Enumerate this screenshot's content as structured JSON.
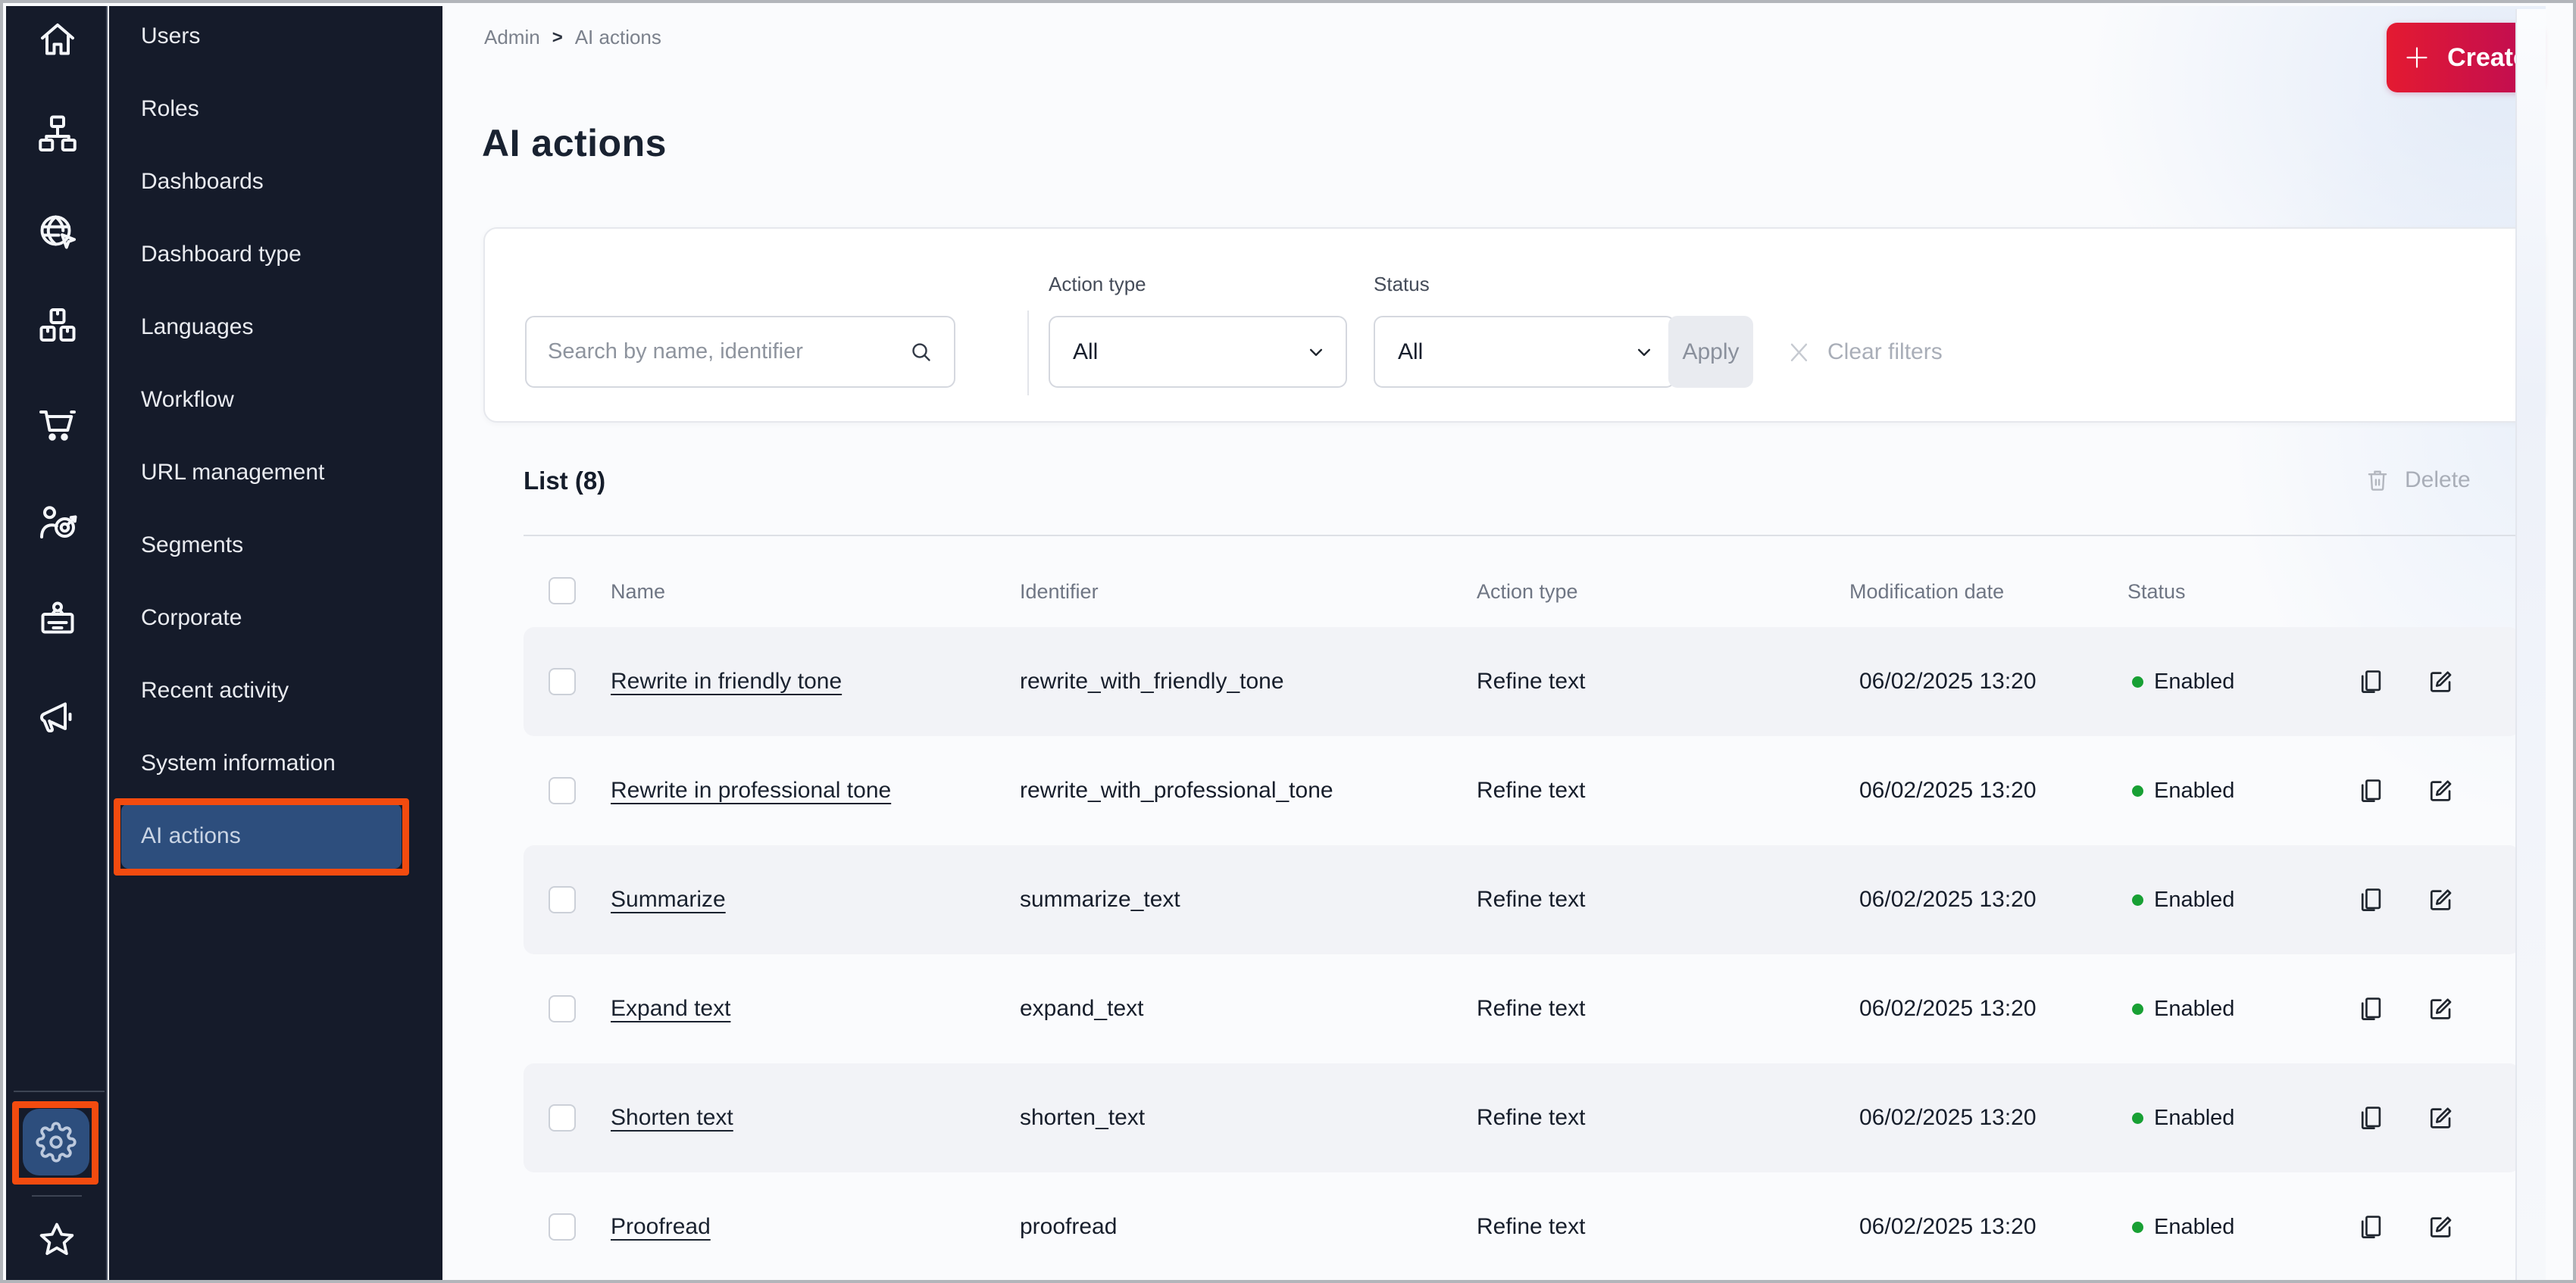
{
  "sidebar": {
    "rail_icons": [
      "home",
      "sitemap",
      "globe-pointer",
      "packages",
      "shopping-cart",
      "audience-target",
      "id-badge",
      "megaphone",
      "settings-gear",
      "star"
    ],
    "menu_items": [
      {
        "label": "Users"
      },
      {
        "label": "Roles"
      },
      {
        "label": "Dashboards"
      },
      {
        "label": "Dashboard type"
      },
      {
        "label": "Languages"
      },
      {
        "label": "Workflow"
      },
      {
        "label": "URL management"
      },
      {
        "label": "Segments"
      },
      {
        "label": "Corporate"
      },
      {
        "label": "Recent activity"
      },
      {
        "label": "System information"
      },
      {
        "label": "AI actions",
        "selected": true
      }
    ]
  },
  "breadcrumb": {
    "items": [
      "Admin",
      "AI actions"
    ],
    "separator": ">"
  },
  "page": {
    "title": "AI actions"
  },
  "toolbar": {
    "create_label": "Create"
  },
  "filters": {
    "search_placeholder": "Search by name, identifier",
    "action_type_label": "Action type",
    "action_type_value": "All",
    "status_label": "Status",
    "status_value": "All",
    "apply_label": "Apply",
    "clear_label": "Clear filters"
  },
  "list": {
    "title": "List (8)",
    "delete_label": "Delete",
    "columns": [
      "Name",
      "Identifier",
      "Action type",
      "Modification date",
      "Status"
    ],
    "rows": [
      {
        "name": "Rewrite in friendly tone",
        "identifier": "rewrite_with_friendly_tone",
        "action_type": "Refine text",
        "date": "06/02/2025 13:20",
        "status": "Enabled"
      },
      {
        "name": "Rewrite in professional tone",
        "identifier": "rewrite_with_professional_tone",
        "action_type": "Refine text",
        "date": "06/02/2025 13:20",
        "status": "Enabled"
      },
      {
        "name": "Summarize",
        "identifier": "summarize_text",
        "action_type": "Refine text",
        "date": "06/02/2025 13:20",
        "status": "Enabled"
      },
      {
        "name": "Expand text",
        "identifier": "expand_text",
        "action_type": "Refine text",
        "date": "06/02/2025 13:20",
        "status": "Enabled"
      },
      {
        "name": "Shorten text",
        "identifier": "shorten_text",
        "action_type": "Refine text",
        "date": "06/02/2025 13:20",
        "status": "Enabled"
      },
      {
        "name": "Proofread",
        "identifier": "proofread",
        "action_type": "Refine text",
        "date": "06/02/2025 13:20",
        "status": "Enabled"
      }
    ]
  },
  "colors": {
    "sidebar_bg": "#151b2a",
    "selected_blue": "#2d4e7d",
    "annotation_orange": "#f24b0f",
    "status_green": "#18a034",
    "accent_start": "#e41a31",
    "accent_end": "#bd0c55"
  }
}
